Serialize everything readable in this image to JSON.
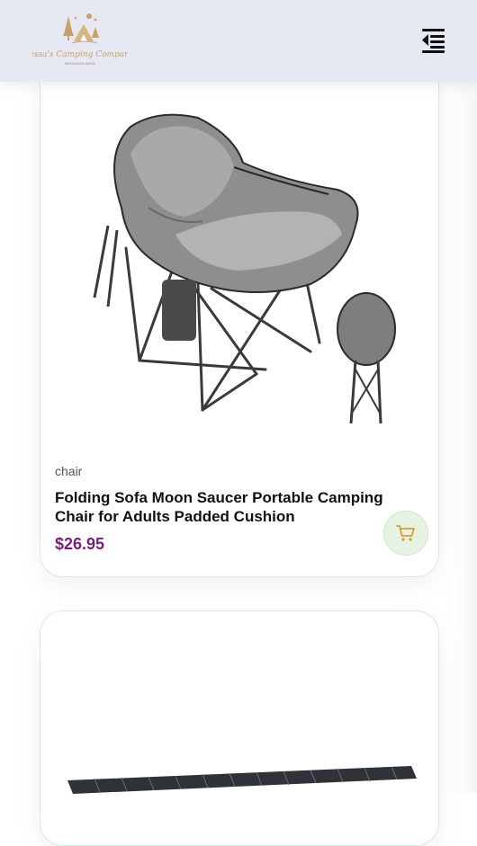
{
  "header": {
    "logo_text": "Jessa's Camping Company",
    "logo_subtext": "ARKANSAS MADE",
    "menu_icon": "menu-collapse-icon"
  },
  "products": [
    {
      "category": "chair",
      "title": "Folding Sofa Moon Saucer Portable Camping Chair for Adults Padded Cushion",
      "price": "$26.95",
      "image": "camping-chair-image",
      "cart_icon": "cart-icon"
    },
    {
      "image": "camping-table-image"
    }
  ],
  "colors": {
    "header_bg": "#e6e8f4",
    "price": "#7b1e7a",
    "cart_bg": "#e6f3e3",
    "cart_icon": "#d4a038",
    "card_border": "#d6ecdc",
    "logo": "#c9a06a"
  }
}
